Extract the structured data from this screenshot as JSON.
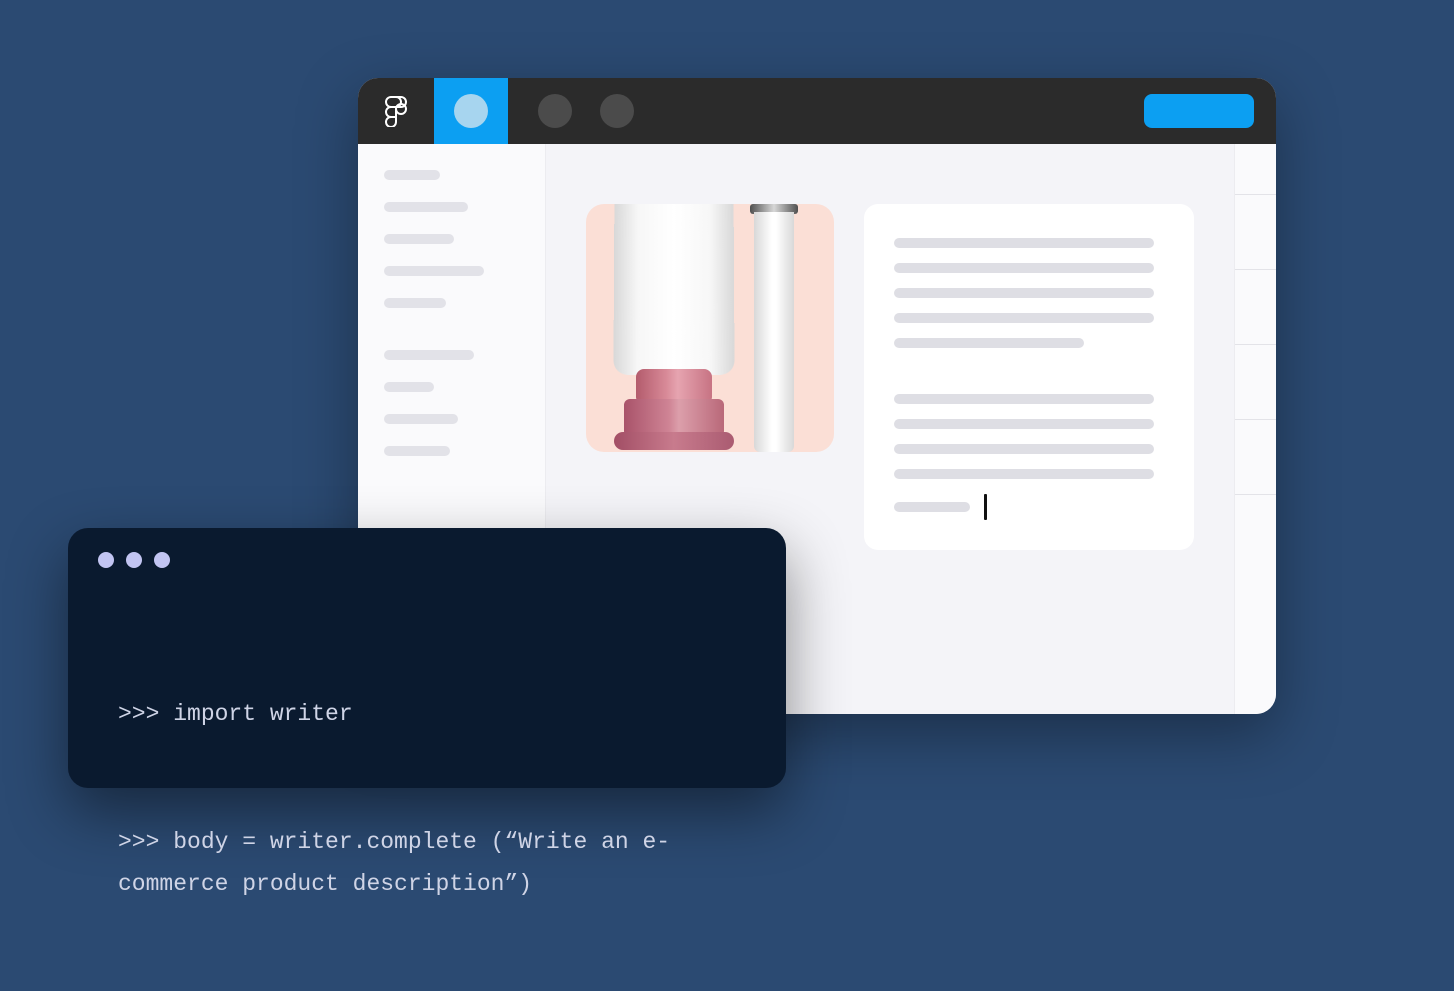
{
  "app": {
    "titlebar": {
      "logo": "figma-logo",
      "active_tab_icon": "document-circle",
      "inactive_tabs": 2,
      "action_button": "share"
    },
    "sidebar": {
      "group1_widths": [
        56,
        84,
        70,
        100,
        62
      ],
      "group2_widths": [
        90,
        50,
        74,
        66
      ]
    },
    "canvas": {
      "product_image": {
        "alt": "cosmetics tube and pen on pink background",
        "items": [
          "cosmetic-tube",
          "cosmetic-pen"
        ],
        "bg": "#fbdfd6"
      },
      "text_panel": {
        "paragraph1_line_widths": [
          260,
          260,
          260,
          260,
          190
        ],
        "paragraph2_line_widths": [
          260,
          260,
          260,
          260
        ],
        "trailing_fragment_width": 76
      }
    }
  },
  "terminal": {
    "prompt": ">>>",
    "lines": [
      ">>> import writer",
      ">>> body = writer.complete (“Write an e-commerce product description”)"
    ],
    "line_ids": [
      "l0",
      "l1"
    ]
  },
  "colors": {
    "page_bg": "#2b4a72",
    "accent": "#0c9ff2",
    "terminal_bg": "#0a1a2f",
    "terminal_fg": "#cfd4e6",
    "traffic_light": "#c2c5f2"
  }
}
